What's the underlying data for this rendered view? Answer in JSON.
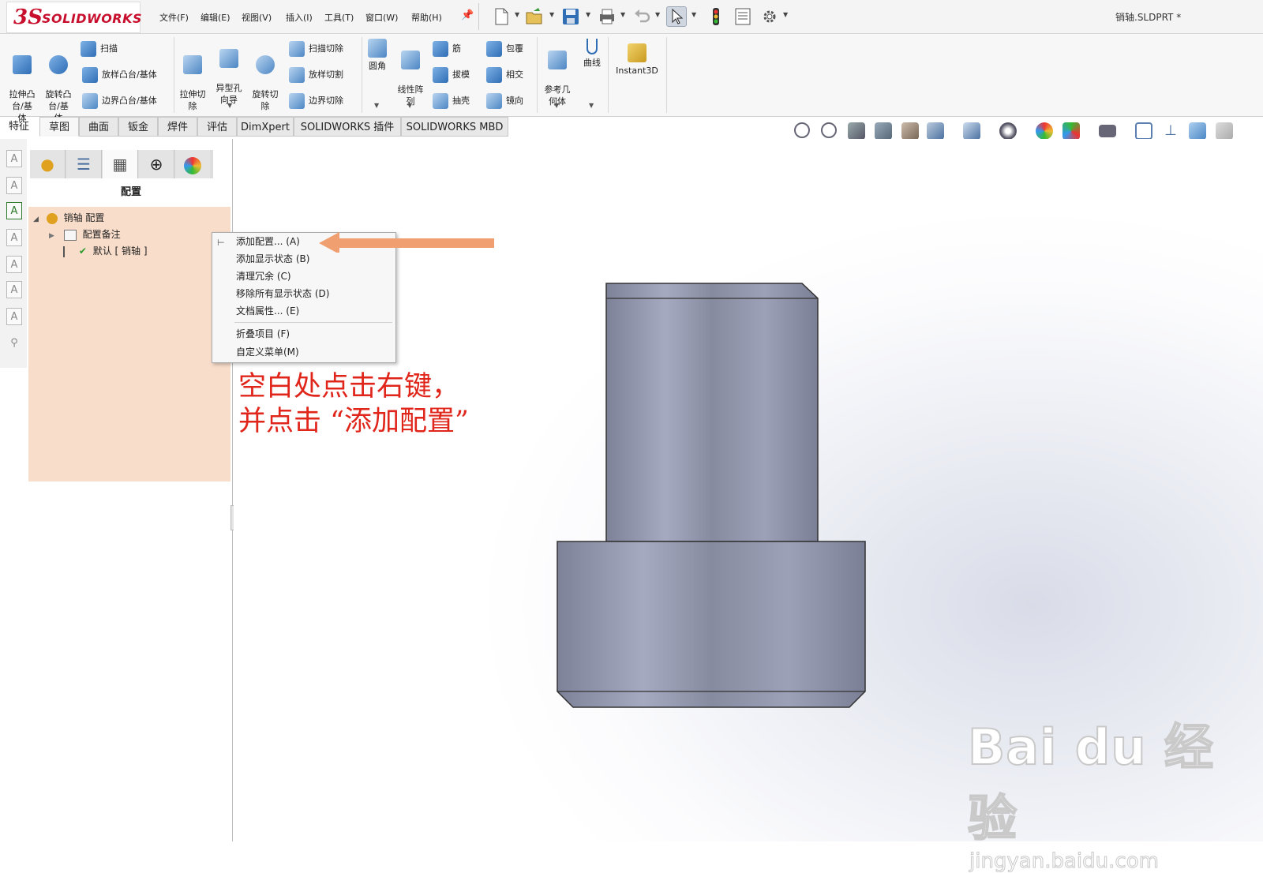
{
  "app": {
    "logo_ds": "3S",
    "logo_text": "SOLIDWORKS",
    "file_title": "销轴.SLDPRT *",
    "menu": [
      "文件(F)",
      "编辑(E)",
      "视图(V)",
      "插入(I)",
      "工具(T)",
      "窗口(W)",
      "帮助(H)"
    ]
  },
  "ribbon": {
    "extrude_boss": "拉伸凸\n台/基\n体",
    "revolve_boss": "旋转凸\n台/基\n体",
    "sweep": "扫描",
    "loft_boss": "放样凸台/基体",
    "boundary_boss": "边界凸台/基体",
    "extrude_cut": "拉伸切\n除",
    "hole_wizard": "异型孔\n向导",
    "revolve_cut": "旋转切\n除",
    "sweep_cut": "扫描切除",
    "loft_cut": "放样切割",
    "boundary_cut": "边界切除",
    "fillet": "圆角",
    "linear_pattern": "线性阵\n列",
    "rib": "筋",
    "wrap": "包覆",
    "draft": "拔模",
    "intersect": "相交",
    "shell": "抽壳",
    "mirror": "镜向",
    "ref_geometry": "参考几\n何体",
    "curves": "曲线",
    "instant3d": "Instant3D"
  },
  "tabs": [
    "特征",
    "草图",
    "曲面",
    "钣金",
    "焊件",
    "评估",
    "DimXpert",
    "SOLIDWORKS 插件",
    "SOLIDWORKS MBD"
  ],
  "panel": {
    "title": "配置",
    "tree": {
      "root": "销轴 配置",
      "notes": "配置备注",
      "default": "默认 [ 销轴 ]"
    }
  },
  "context_menu": {
    "items": [
      "添加配置... (A)",
      "添加显示状态 (B)",
      "清理冗余 (C)",
      "移除所有显示状态 (D)",
      "文档属性... (E)",
      "折叠项目 (F)",
      "自定义菜单(M)"
    ]
  },
  "annotation": {
    "line1": "空白处点击右键，",
    "line2": "并点击  “添加配置”"
  },
  "watermark": {
    "big": "Bai du 经验",
    "small": "jingyan.baidu.com"
  },
  "colors": {
    "brand": "#c8102e",
    "annotation": "#e0251b",
    "arrow": "#f0a070",
    "panel_highlight": "#f8ddca",
    "part_body": "#8e92a6"
  }
}
